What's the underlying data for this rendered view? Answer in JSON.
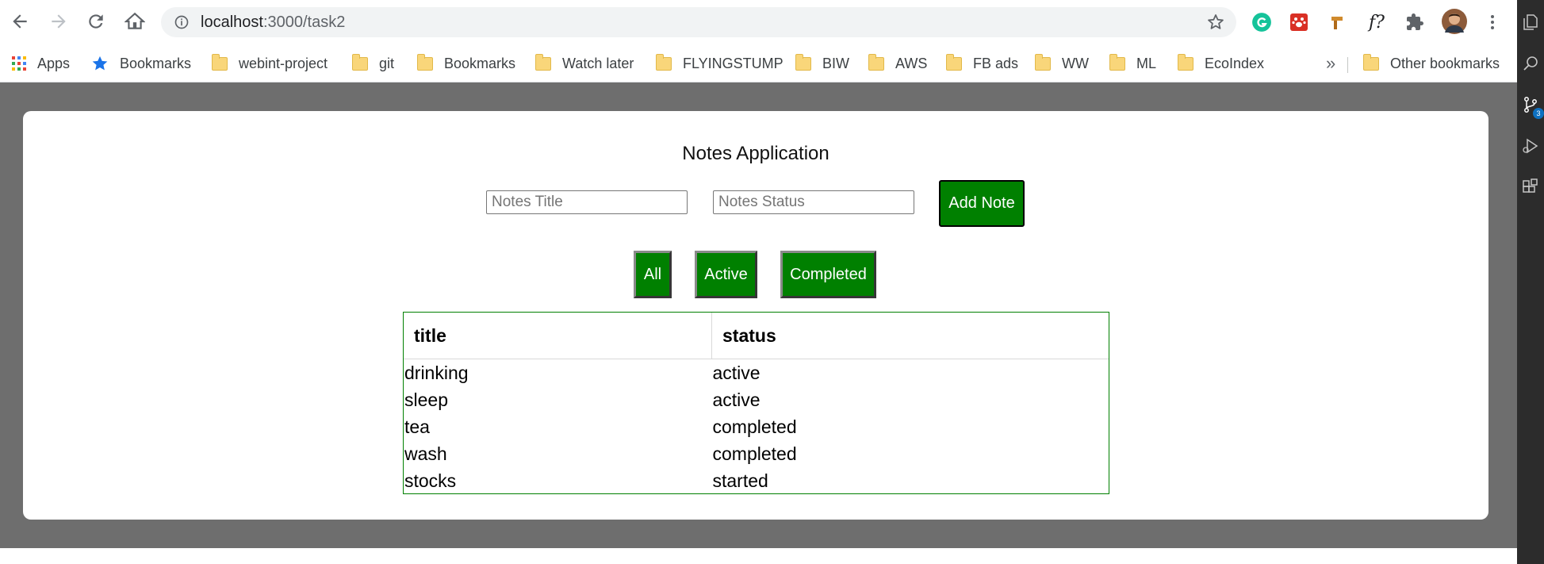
{
  "browser": {
    "url_host": "localhost",
    "url_path": ":3000/task2",
    "bookmarks": [
      {
        "label": "Apps",
        "kind": "apps"
      },
      {
        "label": "Bookmarks",
        "kind": "star"
      },
      {
        "label": "webint-project",
        "kind": "folder"
      },
      {
        "label": "git",
        "kind": "folder"
      },
      {
        "label": "Bookmarks",
        "kind": "folder"
      },
      {
        "label": "Watch later",
        "kind": "folder"
      },
      {
        "label": "FLYINGSTUMP",
        "kind": "folder"
      },
      {
        "label": "BIW",
        "kind": "folder"
      },
      {
        "label": "AWS",
        "kind": "folder"
      },
      {
        "label": "FB ads",
        "kind": "folder"
      },
      {
        "label": "WW",
        "kind": "folder"
      },
      {
        "label": "ML",
        "kind": "folder"
      },
      {
        "label": "EcoIndex",
        "kind": "folder"
      }
    ],
    "overflow_label": "»",
    "other_bookmarks": "Other bookmarks",
    "extensions": [
      "grammarly-icon",
      "paw-extension-icon",
      "hammer-extension-icon",
      "formula-extension-icon",
      "puzzle-extensions-icon",
      "profile-avatar"
    ],
    "extension_formula_label": "f?"
  },
  "sidebar": {
    "scm_badge": "3"
  },
  "app": {
    "title": "Notes Application",
    "title_input_placeholder": "Notes Title",
    "status_input_placeholder": "Notes Status",
    "add_button_label": "Add Note",
    "filters": {
      "all": "All",
      "active": "Active",
      "completed": "Completed"
    },
    "table": {
      "headers": {
        "title": "title",
        "status": "status"
      },
      "rows": [
        {
          "title": "drinking",
          "status": "active"
        },
        {
          "title": "sleep",
          "status": "active"
        },
        {
          "title": "tea",
          "status": "completed"
        },
        {
          "title": "wash",
          "status": "completed"
        },
        {
          "title": "stocks",
          "status": "started"
        }
      ]
    }
  },
  "colors": {
    "accent_green": "#008000",
    "page_background": "#6e6e6e",
    "card_background": "#ffffff"
  }
}
